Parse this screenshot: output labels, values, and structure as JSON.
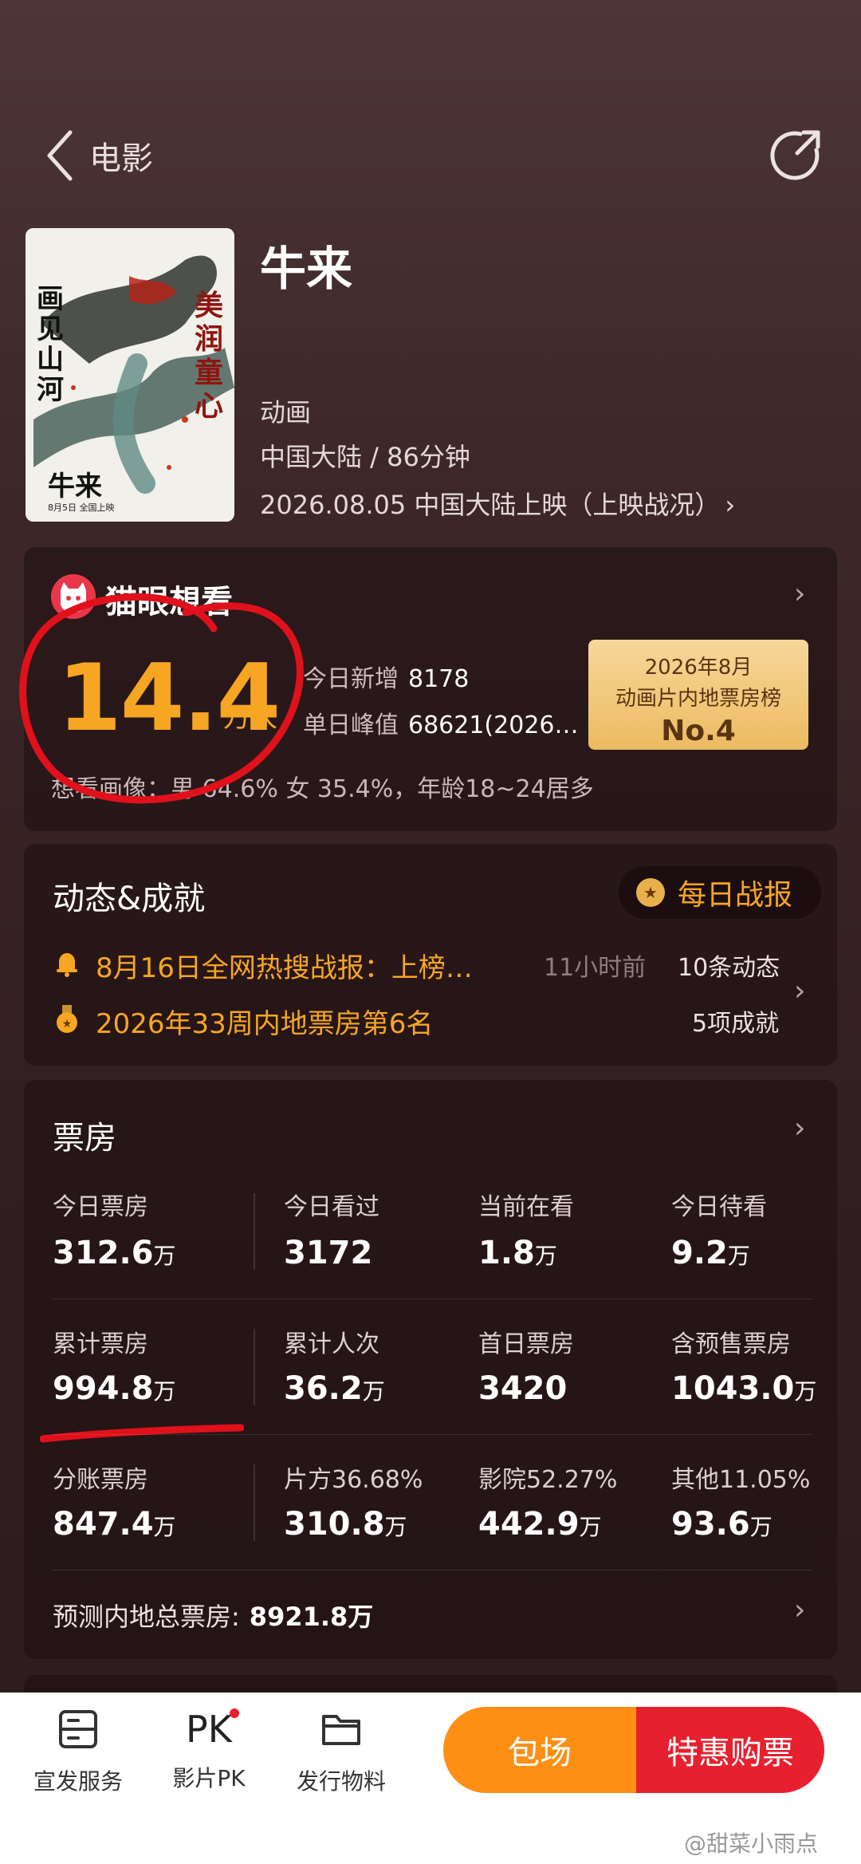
{
  "header": {
    "title": "电影"
  },
  "movie": {
    "title": "牛来",
    "genre": "动画",
    "region_duration": "中国大陆 / 86分钟",
    "release": "2026.08.05 中国大陆上映（上映战况）",
    "poster_text": {
      "left": "画见山河",
      "right": "美润童心",
      "name": "牛来",
      "date": "8月5日 全国上映"
    }
  },
  "want": {
    "title": "猫眼想看",
    "number": "14.4",
    "unit": "万人",
    "today_label": "今日新增",
    "today_value": "8178",
    "peak_label": "单日峰值",
    "peak_value": "68621(2026…",
    "badge_line1": "2026年8月",
    "badge_line2": "动画片内地票房榜",
    "badge_line3": "No.4",
    "profile": "想看画像：男 64.6%  女 35.4%，年龄18~24居多"
  },
  "news": {
    "title": "动态&成就",
    "daily_button": "每日战报",
    "item1": "8月16日全网热搜战报：上榜…",
    "item1_time": "11小时前",
    "item1_count": "10条动态",
    "item2": "2026年33周内地票房第6名",
    "item2_count": "5项成就"
  },
  "box_office": {
    "title": "票房",
    "rows": [
      [
        {
          "label": "今日票房",
          "value": "312.6",
          "unit": "万"
        },
        {
          "label": "今日看过",
          "value": "3172",
          "unit": ""
        },
        {
          "label": "当前在看",
          "value": "1.8",
          "unit": "万"
        },
        {
          "label": "今日待看",
          "value": "9.2",
          "unit": "万"
        }
      ],
      [
        {
          "label": "累计票房",
          "value": "994.8",
          "unit": "万"
        },
        {
          "label": "累计人次",
          "value": "36.2",
          "unit": "万"
        },
        {
          "label": "首日票房",
          "value": "3420",
          "unit": ""
        },
        {
          "label": "含预售票房",
          "value": "1043.0",
          "unit": "万"
        }
      ],
      [
        {
          "label": "分账票房",
          "value": "847.4",
          "unit": "万"
        },
        {
          "label": "片方36.68%",
          "value": "310.8",
          "unit": "万"
        },
        {
          "label": "影院52.27%",
          "value": "442.9",
          "unit": "万"
        },
        {
          "label": "其他11.05%",
          "value": "93.6",
          "unit": "万"
        }
      ]
    ],
    "forecast_label": "预测内地总票房:",
    "forecast_value": "8921.8万"
  },
  "bottom": {
    "tool1": "宣发服务",
    "tool2": "影片PK",
    "tool3": "发行物料",
    "pk_icon": "PK",
    "btn_left": "包场",
    "btn_right": "特惠购票",
    "watermark": "@甜菜小雨点"
  },
  "colors": {
    "accent": "#f6a623",
    "buy": "#e7202f",
    "book": "#fd8f14",
    "annotation": "#e0111b"
  }
}
